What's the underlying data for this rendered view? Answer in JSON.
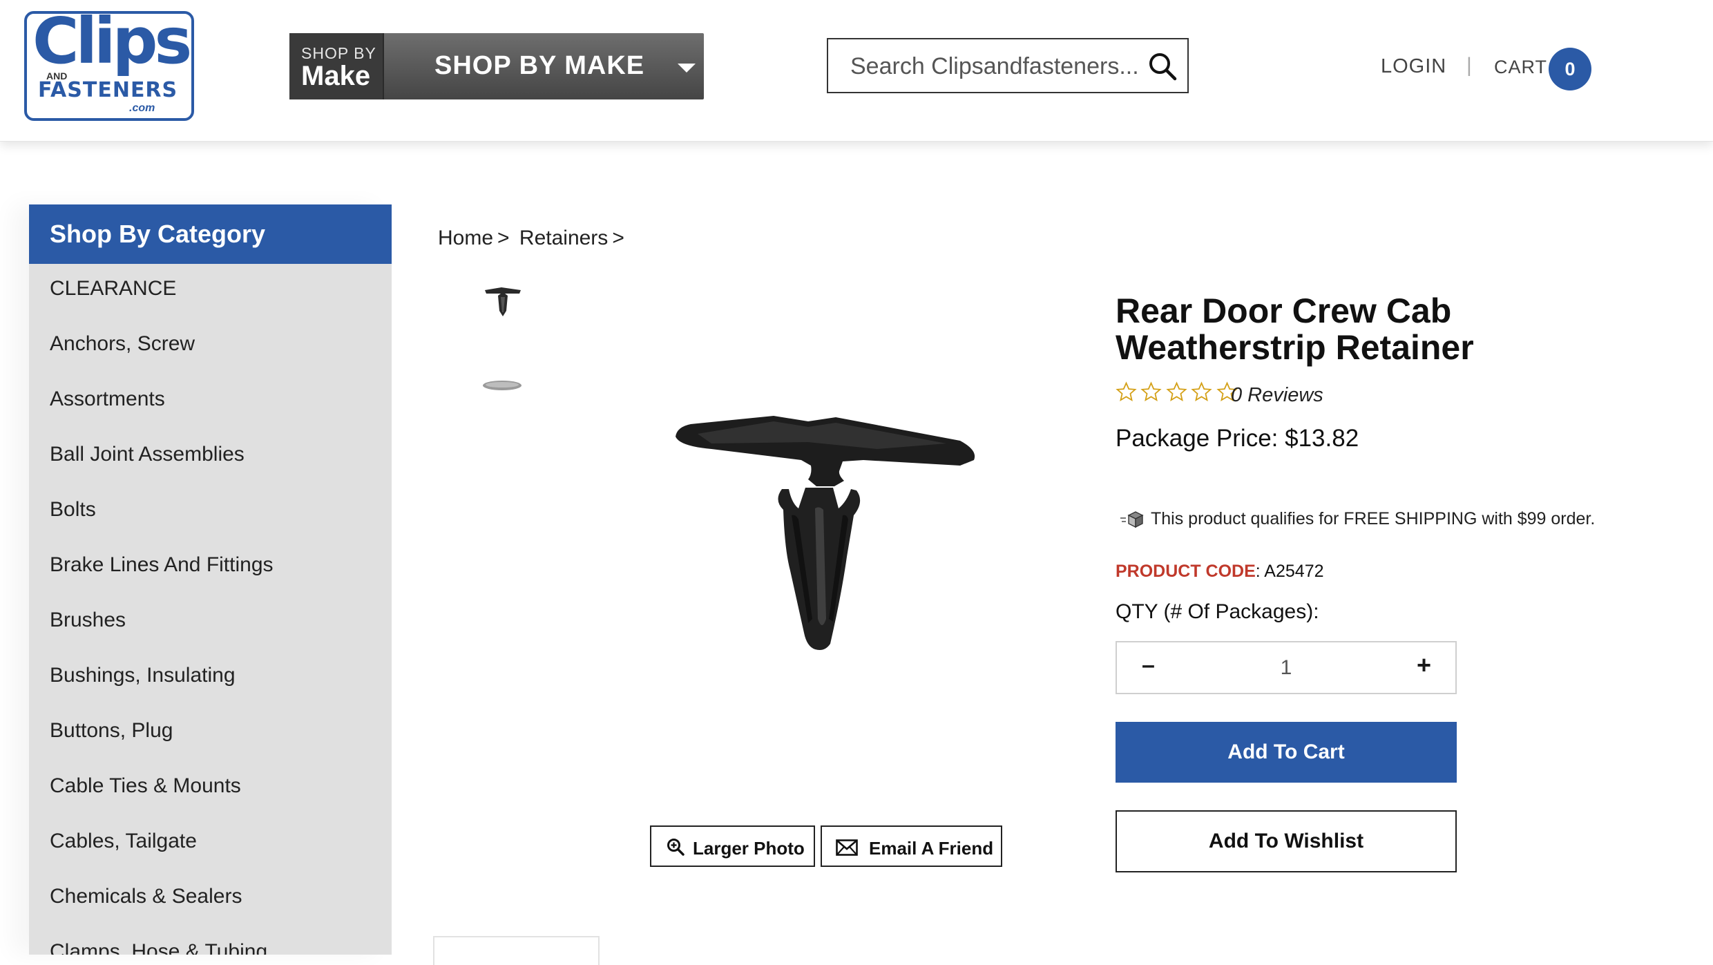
{
  "header": {
    "logo": {
      "line1": "Clips",
      "and": "AND",
      "line2": "FASTENERS",
      "domain": ".com"
    },
    "shop_by_make": {
      "small": "SHOP BY",
      "big": "Make",
      "label": "SHOP BY MAKE"
    },
    "search": {
      "placeholder": "Search Clipsandfasteners..."
    },
    "login": "LOGIN",
    "separator": "|",
    "cart": {
      "label": "CART",
      "count": "0"
    }
  },
  "sidebar": {
    "title": "Shop By Category",
    "items": [
      "CLEARANCE",
      "Anchors, Screw",
      "Assortments",
      "Ball Joint Assemblies",
      "Bolts",
      "Brake Lines And Fittings",
      "Brushes",
      "Bushings, Insulating",
      "Buttons, Plug",
      "Cable Ties & Mounts",
      "Cables, Tailgate",
      "Chemicals & Sealers",
      "Clamps, Hose & Tubing"
    ]
  },
  "breadcrumb": {
    "home": "Home",
    "sep1": ">",
    "category": "Retainers",
    "sep2": ">"
  },
  "gallery": {
    "larger_photo": "Larger Photo",
    "email_friend": "Email A Friend"
  },
  "product": {
    "title": "Rear Door Crew Cab Weatherstrip Retainer",
    "rating": 0,
    "reviews": "0 Reviews",
    "price": "Package Price: $13.82",
    "shipping": "This product qualifies for FREE SHIPPING with $99 order.",
    "code_label": "PRODUCT CODE",
    "code": ": A25472",
    "qty_label": "QTY (# Of Packages):",
    "qty_value": "1",
    "add_to_cart": "Add To Cart",
    "add_to_wishlist": "Add To Wishlist"
  },
  "colors": {
    "brand_blue": "#2b5aa6",
    "code_red": "#c0392b",
    "star_gold": "#d4a017"
  }
}
